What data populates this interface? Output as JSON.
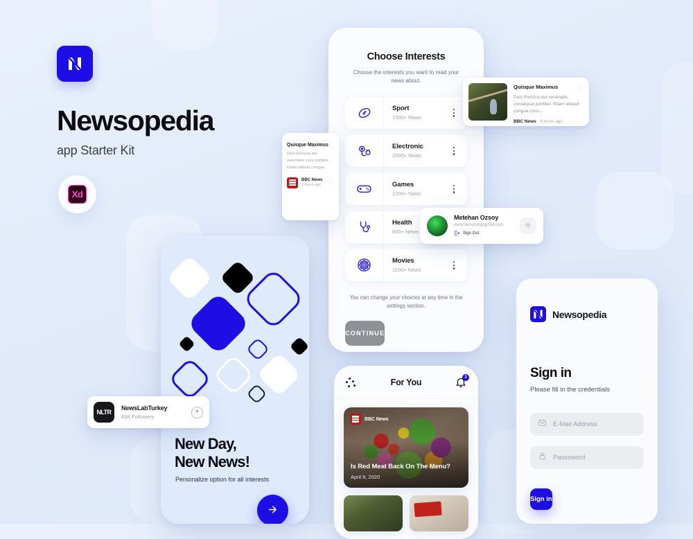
{
  "brand": {
    "logo_icon": "newsopedia-n-logo",
    "title": "Newsopedia",
    "subtitle": "app Starter Kit",
    "tool_badge": "Xd",
    "accent_color": "#1d0ee6",
    "background_color": "#e3ecfb"
  },
  "interests_screen": {
    "title": "Choose Interests",
    "subtitle": "Choose the interests you want to read your news about.",
    "items": [
      {
        "icon": "football-icon",
        "name": "Sport",
        "count": "1500+ News"
      },
      {
        "icon": "plug-icon",
        "name": "Electronic",
        "count": "2000+ News"
      },
      {
        "icon": "gamepad-icon",
        "name": "Games",
        "count": "1200+ News"
      },
      {
        "icon": "stethoscope-icon",
        "name": "Health",
        "count": "800+ News"
      },
      {
        "icon": "film-reel-icon",
        "name": "Movies",
        "count": "1100+ News"
      }
    ],
    "note": "You can change your choices at any time in the settings section.",
    "continue_label": "CONTINUE"
  },
  "foryou_screen": {
    "menu_icon": "scatter-dots-icon",
    "title": "For You",
    "bell_icon": "bell-icon",
    "notification_count": "3",
    "hero": {
      "source": "BBC News",
      "source_icon": "bbc-news-logo",
      "title": "Is Red Meat Back On The Menu?",
      "date": "April 9, 2020"
    },
    "tiles": [
      "news-thumb-forest",
      "news-thumb-magazine"
    ]
  },
  "onboarding_screen": {
    "logo_icon": "newsopedia-n-logo",
    "heading_line1": "New Day,",
    "heading_line2": "New News!",
    "subtitle": "Personalize option for all interests",
    "fab_icon": "arrow-right-icon"
  },
  "signin_panel": {
    "brand_logo_icon": "newsopedia-n-logo",
    "brand_name": "Newsopedia",
    "heading": "Sign in",
    "subheading": "Please fill in the credentials",
    "email_field": {
      "icon": "mail-icon",
      "placeholder": "E-Mail Address",
      "value": ""
    },
    "password_field": {
      "icon": "lock-icon",
      "placeholder": "Passsword",
      "value": ""
    },
    "submit_label": "Sign in"
  },
  "news_card_wide": {
    "thumb": "heron-photo",
    "title": "Quisque Maximus",
    "description": "Duis rhoncus dui venenatis consequat porttitor. Etiam aliquet congue cons...",
    "source": "BBC News",
    "time": "6 hours ago",
    "star_icon": "star-outline-icon"
  },
  "news_card_tall": {
    "thumb": "heron-photo",
    "title": "Quisque Maximus",
    "description": "Duis rhoncus dui venenatis cons porttitor. Etiam aliquet congue..",
    "source": "BBC News",
    "source_icon": "bbc-news-logo",
    "time": "2 hours ago",
    "star_icon": "star-outline-icon"
  },
  "profile_card": {
    "avatar": "user-avatar",
    "name": "Metehan Ozsoy",
    "email": "metehanozsot@gmail.com",
    "signout_label": "Sign Out",
    "signout_icon": "signout-icon",
    "settings_icon": "gear-icon"
  },
  "publisher_card": {
    "mark": "NLTR",
    "name": "NewsLabTurkey",
    "followers": "45K Followers",
    "add_icon": "plus-icon"
  }
}
